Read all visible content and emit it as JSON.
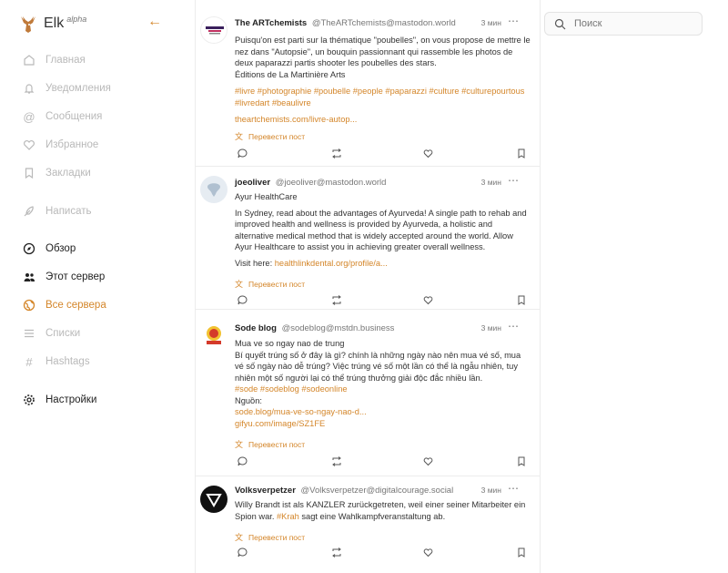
{
  "app": {
    "name": "Elk",
    "badge": "alpha"
  },
  "nav": {
    "home": "Главная",
    "notifications": "Уведомления",
    "messages": "Сообщения",
    "favourites": "Избранное",
    "bookmarks": "Закладки",
    "compose": "Написать",
    "explore": "Обзор",
    "local": "Этот сервер",
    "federated": "Все сервера",
    "lists": "Списки",
    "hashtags": "Hashtags",
    "settings": "Настройки"
  },
  "search": {
    "placeholder": "Поиск"
  },
  "posts": [
    {
      "name": "The ARTchemists",
      "handle": "@TheARTchemists@mastodon.world",
      "time": "3 мин",
      "text": "Puisqu'on est parti sur la thématique \"poubelles\", on vous propose de mettre le nez dans \"Autopsie\", un bouquin passionnant qui rassemble les photos de deux paparazzi partis shooter les poubelles des stars.",
      "text2": "Éditions de La Martinière Arts",
      "tags": "#livre #photographie #poubelle #people #paparazzi #culture #culturepourtous #livredart #beaulivre",
      "link": "theartchemists.com/livre-autop...",
      "translate": "Перевести пост"
    },
    {
      "name": "joeoliver",
      "handle": "@joeoliver@mastodon.world",
      "time": "3 мин",
      "title": "Ayur HealthCare",
      "text": "In Sydney, read about the advantages of Ayurveda! A single path to rehab and improved health and wellness is provided by Ayurveda, a holistic and alternative medical method that is widely accepted around the world. Allow Ayur Healthcare to assist you in achieving greater overall wellness.",
      "visit": "Visit here:",
      "link": "healthlinkdental.org/profile/a...",
      "translate": "Перевести пост"
    },
    {
      "name": "Sode blog",
      "handle": "@sodeblog@mstdn.business",
      "time": "3 мин",
      "title": "Mua ve so ngay nao de trung",
      "text": "Bí quyết trúng số ở đây là gì? chính là những ngày nào nên mua vé số, mua vé số ngày nào dễ trúng? Việc trúng vé số một lần có thể là ngẫu nhiên, tuy nhiên một số người lại có thể trúng thưởng giải độc đắc nhiều lần.",
      "tags": "#sode #sodeblog #sodeonline",
      "source": "Nguồn:",
      "link": "sode.blog/mua-ve-so-ngay-nao-d...",
      "link2": "gifyu.com/image/SZ1FE",
      "translate": "Перевести пост"
    },
    {
      "name": "Volksverpetzer",
      "handle": "@Volksverpetzer@digitalcourage.social",
      "time": "3 мин",
      "text_pre": "Willy Brandt ist als KANZLER zurückgetreten, weil einer seiner Mitarbeiter ein Spion war. ",
      "tag": "#Krah",
      "text_post": " sagt eine Wahlkampfveranstaltung ab.",
      "translate": "Перевести пост"
    }
  ],
  "colors": {
    "accent": "#d4862a",
    "disabled": "#b9b9b9"
  }
}
